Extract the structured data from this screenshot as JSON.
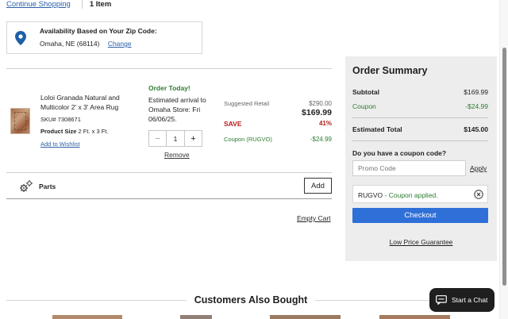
{
  "topbar": {
    "continue": "Continue Shopping",
    "item_count": "1 Item"
  },
  "zip": {
    "title": "Availability Based on Your Zip Code:",
    "location": "Omaha, NE (68114)",
    "change": "Change",
    "icon": "map-pin-icon"
  },
  "product": {
    "name": "Loloi Granada Natural and Multicolor 2' x 3' Area Rug",
    "sku": "SKU# 7308671",
    "size_label": "Product Size",
    "size_value": "2 Ft. x 3 Ft.",
    "wishlist": "Add to Wishlist",
    "order_today": "Order Today!",
    "arrival": "Estimated arrival to Omaha Store: Fri 06/06/25.",
    "quantity": "1",
    "minus": "−",
    "plus": "+",
    "remove": "Remove",
    "suggested_label": "Suggested Retail",
    "suggested_value": "$290.00",
    "price": "$169.99",
    "save_label": "SAVE",
    "save_value": "41%",
    "coupon_label": "Coupon (RUGVO)",
    "coupon_value": "-$24.99"
  },
  "parts": {
    "label": "Parts",
    "add": "Add",
    "icon": "gears-icon"
  },
  "empty_cart": "Empty Cart",
  "summary": {
    "title": "Order Summary",
    "subtotal_label": "Subtotal",
    "subtotal_value": "$169.99",
    "coupon_label": "Coupon",
    "coupon_value": "-$24.99",
    "total_label": "Estimated Total",
    "total_value": "$145.00",
    "coupon_question": "Do you have a coupon code?",
    "promo_placeholder": "Promo Code",
    "apply": "Apply",
    "applied_code": "RUGVO",
    "applied_msg": " - Coupon applied.",
    "checkout": "Checkout",
    "low_price": "Low Price Guarantee"
  },
  "also_bought": {
    "title": "Customers Also Bought"
  },
  "chat": {
    "label": "Start a Chat",
    "icon": "chat-icon"
  },
  "colors": {
    "link": "#2b5ea8",
    "green": "#2e7d32",
    "red": "#b71c1c",
    "checkout": "#2f6fd8",
    "summary_bg": "#ededed"
  }
}
